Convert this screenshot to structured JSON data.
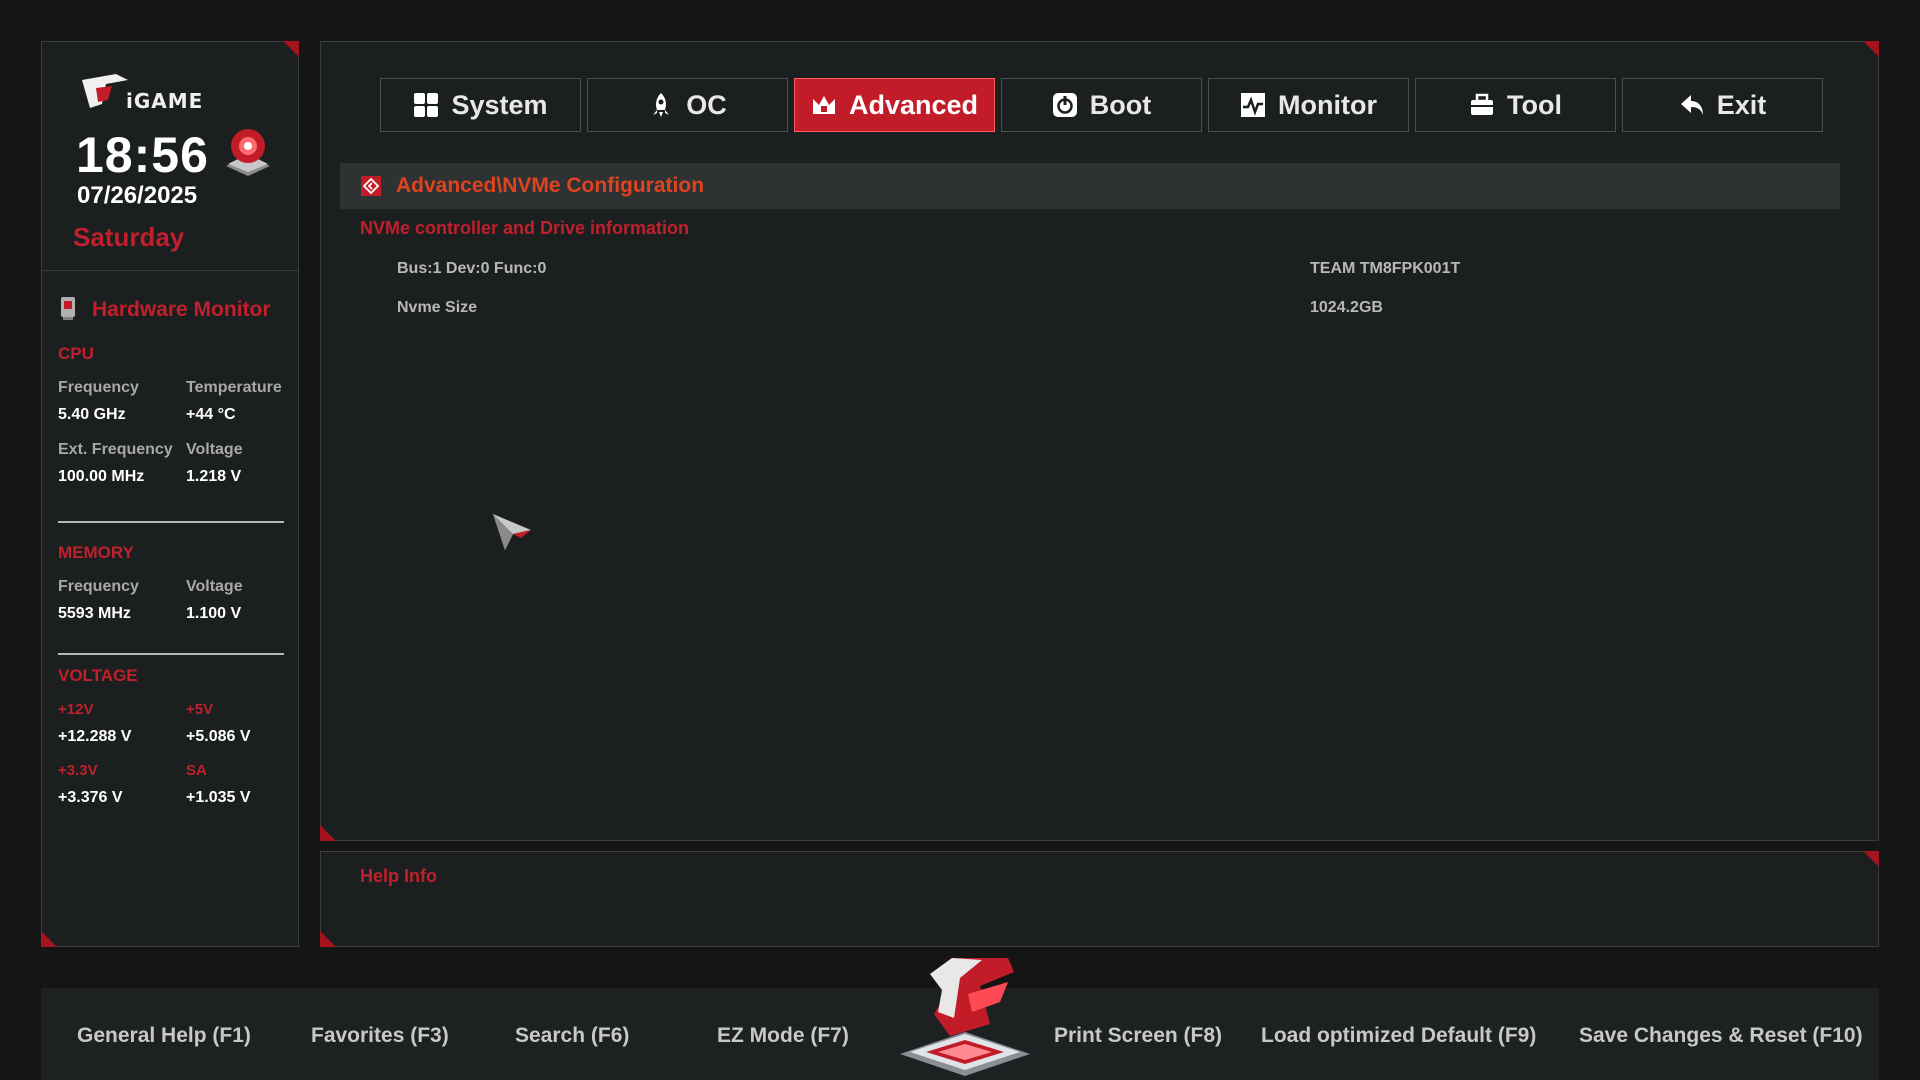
{
  "sidebar": {
    "time": "18:56",
    "date": "07/26/2025",
    "day": "Saturday",
    "hw_title": "Hardware Monitor",
    "cpu": {
      "title": "CPU",
      "freq_label": "Frequency",
      "freq_value": "5.40 GHz",
      "temp_label": "Temperature",
      "temp_value": "+44 °C",
      "ext_label": "Ext. Frequency",
      "ext_value": "100.00 MHz",
      "volt_label": "Voltage",
      "volt_value": "1.218 V"
    },
    "memory": {
      "title": "MEMORY",
      "freq_label": "Frequency",
      "freq_value": "5593 MHz",
      "volt_label": "Voltage",
      "volt_value": "1.100 V"
    },
    "voltage": {
      "title": "VOLTAGE",
      "v12_label": "+12V",
      "v12_value": "+12.288 V",
      "v5_label": "+5V",
      "v5_value": "+5.086 V",
      "v33_label": "+3.3V",
      "v33_value": "+3.376 V",
      "sa_label": "SA",
      "sa_value": "+1.035 V"
    }
  },
  "tabs": [
    {
      "label": "System",
      "icon": "grid-icon",
      "active": false
    },
    {
      "label": "OC",
      "icon": "rocket-icon",
      "active": false
    },
    {
      "label": "Advanced",
      "icon": "crown-icon",
      "active": true
    },
    {
      "label": "Boot",
      "icon": "power-icon",
      "active": false
    },
    {
      "label": "Monitor",
      "icon": "pulse-icon",
      "active": false
    },
    {
      "label": "Tool",
      "icon": "toolbox-icon",
      "active": false
    },
    {
      "label": "Exit",
      "icon": "back-arrow-icon",
      "active": false
    }
  ],
  "main": {
    "breadcrumb": "Advanced\\NVMe Configuration",
    "section_title": "NVMe controller and Drive information",
    "rows": [
      {
        "label": "Bus:1 Dev:0 Func:0",
        "value": "TEAM TM8FPK001T"
      },
      {
        "label": "Nvme Size",
        "value": "1024.2GB"
      }
    ]
  },
  "help": {
    "title": "Help Info"
  },
  "footer": {
    "general_help": "General Help (F1)",
    "favorites": "Favorites (F3)",
    "search": "Search (F6)",
    "ez_mode": "EZ Mode (F7)",
    "print_screen": "Print Screen (F8)",
    "load_default": "Load optimized Default (F9)",
    "save_reset": "Save Changes & Reset (F10)"
  },
  "colors": {
    "accent": "#c21c28",
    "breadcrumb": "#e0431f",
    "panel_bg": "#1c1f1f",
    "page_bg": "#151515"
  }
}
